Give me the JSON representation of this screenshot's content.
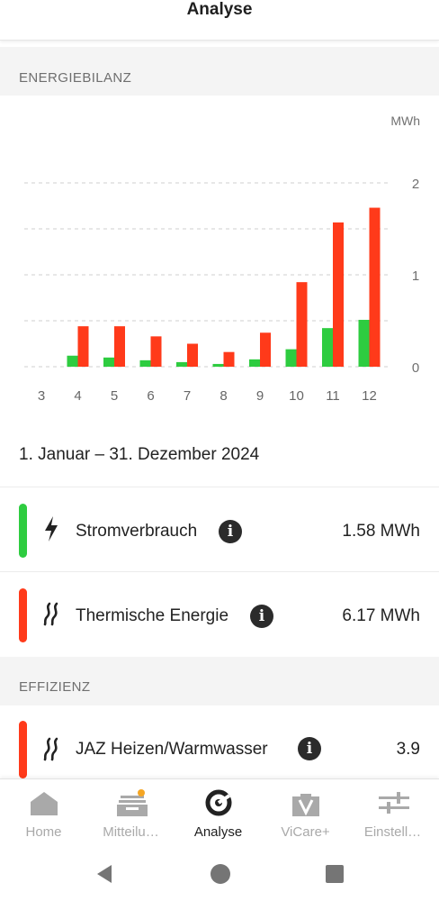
{
  "header": {
    "title": "Analyse"
  },
  "energy_section": {
    "title": "ENERGIEBILANZ"
  },
  "chart_data": {
    "type": "bar",
    "unit_label": "MWh",
    "categories": [
      "3",
      "4",
      "5",
      "6",
      "7",
      "8",
      "9",
      "10",
      "11",
      "12"
    ],
    "y_ticks": [
      "0",
      "1",
      "2"
    ],
    "ylim": [
      0,
      2
    ],
    "grid": true,
    "series": [
      {
        "name": "Stromverbrauch",
        "color": "#2ecc40",
        "values": [
          0,
          0.12,
          0.1,
          0.07,
          0.05,
          0.03,
          0.08,
          0.19,
          0.42,
          0.51
        ]
      },
      {
        "name": "Thermische Energie",
        "color": "#ff3a1a",
        "values": [
          0,
          0.44,
          0.44,
          0.33,
          0.25,
          0.16,
          0.37,
          0.92,
          1.57,
          1.73
        ]
      }
    ]
  },
  "date_range": "1. Januar – 31. Dezember 2024",
  "energy_rows": [
    {
      "label": "Stromverbrauch",
      "value": "1.58 MWh",
      "color": "#2ecc40",
      "icon": "lightning-icon"
    },
    {
      "label": "Thermische Energie",
      "value": "6.17 MWh",
      "color": "#ff3a1a",
      "icon": "heat-waves-icon"
    }
  ],
  "efficiency_section": {
    "title": "EFFIZIENZ"
  },
  "efficiency_rows": [
    {
      "label": "JAZ Heizen/Warmwasser",
      "value": "3.9",
      "color": "#ff3a1a",
      "icon": "heat-waves-icon"
    }
  ],
  "nav": {
    "items": [
      {
        "label": "Home",
        "icon": "home-icon",
        "active": false
      },
      {
        "label": "Mitteilu…",
        "icon": "messages-icon",
        "active": false,
        "badge_color": "#f5a623"
      },
      {
        "label": "Analyse",
        "icon": "analysis-icon",
        "active": true
      },
      {
        "label": "ViCare+",
        "icon": "vicare-icon",
        "active": false
      },
      {
        "label": "Einstell…",
        "icon": "settings-sliders-icon",
        "active": false
      }
    ]
  },
  "system_nav": {
    "back": "back-icon",
    "home": "home-circle-icon",
    "recents": "recents-icon"
  }
}
